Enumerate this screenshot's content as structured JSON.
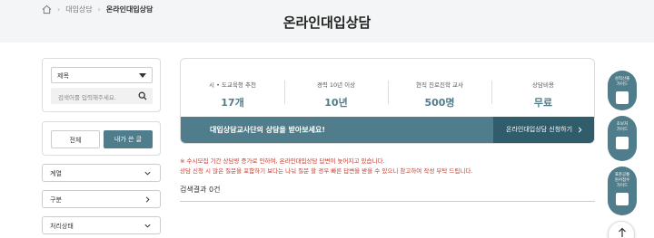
{
  "breadcrumb": {
    "level1": "대입상담",
    "level2": "온라인대입상담"
  },
  "page": {
    "title": "온라인대입상담"
  },
  "search": {
    "select_value": "제목",
    "placeholder": "검색어를 입력해주세요."
  },
  "tabs": {
    "all": "전체",
    "mine": "내가 쓴 글"
  },
  "filters": [
    {
      "label": "계열"
    },
    {
      "label": "구분"
    },
    {
      "label": "처리상태"
    }
  ],
  "stats": [
    {
      "label": "시 • 도교육청 추천",
      "value": "17개"
    },
    {
      "label": "경력 10년 이상",
      "value": "10년"
    },
    {
      "label": "현직 진로진학 교사",
      "value": "500명"
    },
    {
      "label": "상담비용",
      "value": "무료"
    }
  ],
  "cta": {
    "text": "대입상담교사단의 상담을 받아보세요!",
    "button": "온라인대입상담 신청하기"
  },
  "notice": {
    "line1": "※ 수시모집 기간 상담량 증가로 인하여, 온라인대입상담 답변이 늦어지고 있습니다.",
    "line2": "상담 신청 시 많은 질문을 포함하기 보다는 나눠 질문 할 경우 빠른 답변을 받을 수 있으니 참고하여 작성 부탁 드립니다."
  },
  "results": {
    "label": "검색결과 0건"
  },
  "side_buttons": [
    {
      "line1": "성적산출",
      "line2": "가이드"
    },
    {
      "line1": "초보자",
      "line2": "가이드"
    },
    {
      "line1": "표준공통",
      "line2": "원서접수",
      "line3": "가이드"
    }
  ],
  "colors": {
    "accent": "#4f7d8b",
    "accent_dark": "#2f5d6b",
    "notice": "#c0392b"
  }
}
